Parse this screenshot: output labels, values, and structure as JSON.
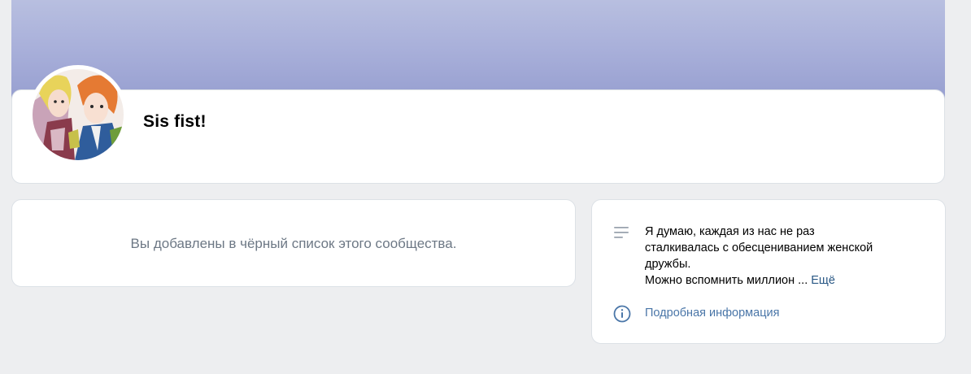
{
  "group": {
    "name": "Sis fist!",
    "cover_color": "#a3aad7"
  },
  "notice": {
    "blocked_text": "Вы добавлены в чёрный список этого сообщества."
  },
  "info": {
    "description_lines": [
      "Я думаю, каждая из нас не раз",
      "сталкивалась с обесцениванием женской",
      "дружбы.",
      "Можно вспомнить миллион ..."
    ],
    "more_label": "Ещё",
    "details_link": "Подробная информация",
    "icons": [
      "description-lines-icon",
      "info-circle-icon"
    ],
    "link_color": "#4a76a8"
  }
}
